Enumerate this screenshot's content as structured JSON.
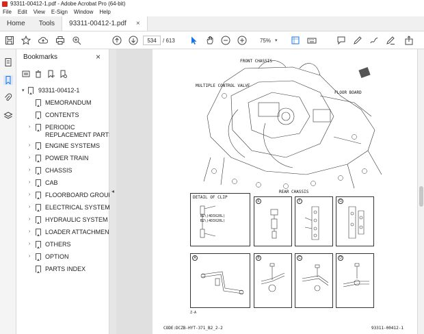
{
  "window": {
    "title": "93311-00412-1.pdf - Adobe Acrobat Pro (64-bit)"
  },
  "menu": [
    "File",
    "Edit",
    "View",
    "E-Sign",
    "Window",
    "Help"
  ],
  "tabs": {
    "home": "Home",
    "tools": "Tools",
    "file": "93311-00412-1.pdf",
    "close": "×"
  },
  "toolbar": {
    "page_current": "534",
    "page_total": "/ 613",
    "zoom": "75%",
    "zoom_caret": "▾"
  },
  "bookmarks_panel": {
    "title": "Bookmarks",
    "close": "×",
    "items": [
      {
        "label": "93311-00412-1",
        "expand": "▾",
        "level": 0
      },
      {
        "label": "MEMORANDUM",
        "expand": "",
        "level": 1
      },
      {
        "label": "CONTENTS",
        "expand": "",
        "level": 1
      },
      {
        "label": "PERIODIC",
        "label2": "REPLACEMENT PARTS",
        "expand": "›",
        "level": 1
      },
      {
        "label": "ENGINE SYSTEMS",
        "expand": "›",
        "level": 1
      },
      {
        "label": "POWER TRAIN",
        "expand": "›",
        "level": 1
      },
      {
        "label": "CHASSIS",
        "expand": "›",
        "level": 1
      },
      {
        "label": "CAB",
        "expand": "›",
        "level": 1
      },
      {
        "label": "FLOORBOARD GROUP",
        "expand": "›",
        "level": 1
      },
      {
        "label": "ELECTRICAL SYSTEM",
        "expand": "›",
        "level": 1
      },
      {
        "label": "HYDRAULIC SYSTEM",
        "expand": "›",
        "level": 1
      },
      {
        "label": "LOADER ATTACHMENT",
        "expand": "›",
        "level": 1
      },
      {
        "label": "OTHERS",
        "expand": "›",
        "level": 1
      },
      {
        "label": "OPTION",
        "expand": "›",
        "level": 1
      },
      {
        "label": "PARTS INDEX",
        "expand": "",
        "level": 1
      }
    ]
  },
  "collapse_handle": "◂",
  "document": {
    "labels": {
      "front_chassis": "FRONT CHASSIS",
      "multiple_control_valve": "MULTIPLE CONTROL VALVE",
      "floor_board": "FLOOR BOARD",
      "rear_chassis": "REAR CHASSIS",
      "detail_of_clip": "DETAIL OF CLIP",
      "clip_note1": "B2\\(4D3X20L)",
      "clip_note2": "B2\\(4D3X20L)",
      "footer_code": "CODE:DCZB-HYT-371_B2_2-2",
      "footer_page": "93311-00412-1",
      "small_id": "Z-A"
    },
    "detail_letters": [
      "E",
      "F",
      "G",
      "A",
      "B",
      "C",
      "D"
    ]
  },
  "colors": {
    "accent": "#1473e6",
    "brand_red": "#d7281e"
  }
}
